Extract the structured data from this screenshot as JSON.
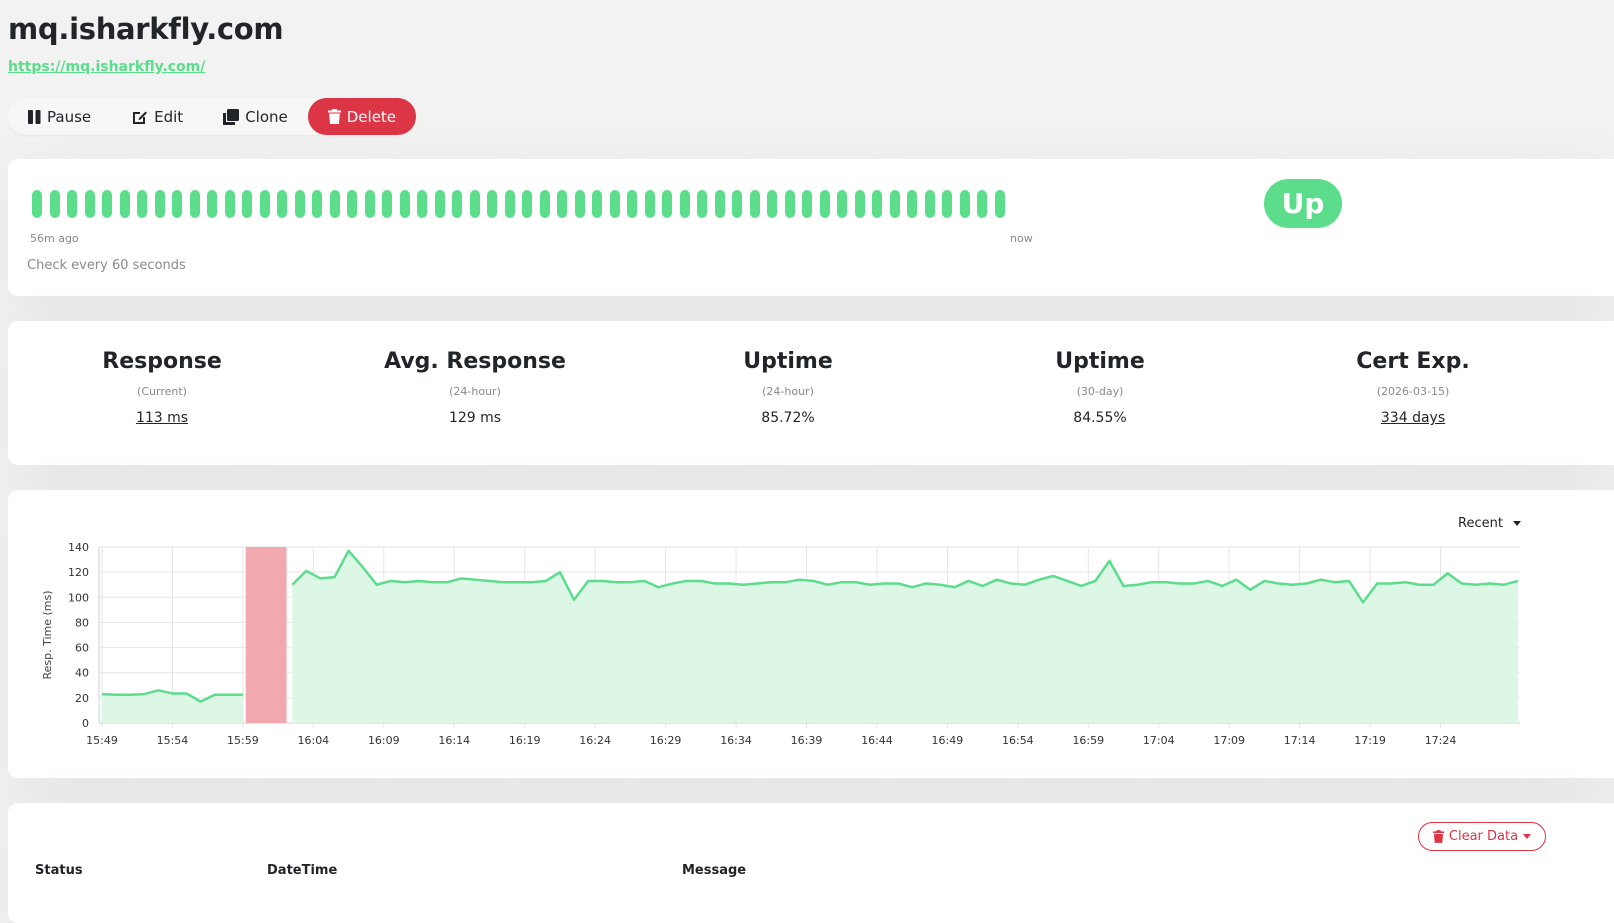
{
  "page": {
    "title": "mq.isharkfly.com",
    "url": "https://mq.isharkfly.com/"
  },
  "toolbar": {
    "pause_label": "Pause",
    "edit_label": "Edit",
    "clone_label": "Clone",
    "delete_label": "Delete"
  },
  "heartbeat": {
    "beat_count": 56,
    "beat_status": "up",
    "left_label": "56m ago",
    "right_label": "now",
    "interval_text": "Check every 60 seconds",
    "status": "Up",
    "colors": {
      "up": "#5cdd8b",
      "down": "#dc3545"
    }
  },
  "stats": [
    {
      "title": "Response",
      "sub": "(Current)",
      "value": "113 ms",
      "link": true
    },
    {
      "title": "Avg. Response",
      "sub": "(24-hour)",
      "value": "129 ms",
      "link": false
    },
    {
      "title": "Uptime",
      "sub": "(24-hour)",
      "value": "85.72%",
      "link": false
    },
    {
      "title": "Uptime",
      "sub": "(30-day)",
      "value": "84.55%",
      "link": false
    },
    {
      "title": "Cert Exp.",
      "sub": "(2026-03-15)",
      "value": "334 days",
      "link": true
    }
  ],
  "chart_period": "Recent",
  "chart_data": {
    "type": "area",
    "ylabel": "Resp. Time (ms)",
    "xlabel": "",
    "ylim": [
      0,
      140
    ],
    "yticks": [
      0,
      20,
      40,
      60,
      80,
      100,
      120,
      140
    ],
    "xticks": [
      "15:49",
      "15:54",
      "15:59",
      "16:04",
      "16:09",
      "16:14",
      "16:19",
      "16:24",
      "16:29",
      "16:34",
      "16:39",
      "16:44",
      "16:49",
      "16:54",
      "16:59",
      "17:04",
      "17:09",
      "17:14",
      "17:19",
      "17:24"
    ],
    "x_range_minutes": [
      0,
      100
    ],
    "line_color": "#5cdd8b",
    "fill_color": "#dcf7e6",
    "down_color": "#f1a8af",
    "down_period": [
      10.2,
      13.1
    ],
    "series": [
      {
        "values": [
          [
            0,
            23
          ],
          [
            1,
            22.5
          ],
          [
            2,
            22.5
          ],
          [
            3,
            23
          ],
          [
            4,
            26
          ],
          [
            5,
            23.5
          ],
          [
            6,
            23.5
          ],
          [
            7,
            17
          ],
          [
            8,
            22.5
          ],
          [
            9,
            22.5
          ],
          [
            10,
            22.5
          ]
        ]
      },
      {
        "values": [
          [
            13.5,
            110
          ],
          [
            14.5,
            121
          ],
          [
            15.5,
            115
          ],
          [
            16.5,
            116
          ],
          [
            17.5,
            137
          ],
          [
            18.5,
            124
          ],
          [
            19.5,
            110
          ],
          [
            20.5,
            113
          ],
          [
            21.5,
            112
          ],
          [
            22.5,
            113
          ],
          [
            23.5,
            112
          ],
          [
            24.5,
            112
          ],
          [
            25.5,
            115
          ],
          [
            26.5,
            114
          ],
          [
            27.5,
            113
          ],
          [
            28.5,
            112
          ],
          [
            29.5,
            112
          ],
          [
            30.5,
            112
          ],
          [
            31.5,
            113
          ],
          [
            32.5,
            120
          ],
          [
            33.5,
            98
          ],
          [
            34.5,
            113
          ],
          [
            35.5,
            113
          ],
          [
            36.5,
            112
          ],
          [
            37.5,
            112
          ],
          [
            38.5,
            113
          ],
          [
            39.5,
            108
          ],
          [
            40.5,
            111
          ],
          [
            41.5,
            113
          ],
          [
            42.5,
            113
          ],
          [
            43.5,
            111
          ],
          [
            44.5,
            111
          ],
          [
            45.5,
            110
          ],
          [
            46.5,
            111
          ],
          [
            47.5,
            112
          ],
          [
            48.5,
            112
          ],
          [
            49.5,
            114
          ],
          [
            50.5,
            113
          ],
          [
            51.5,
            110
          ],
          [
            52.5,
            112
          ],
          [
            53.5,
            112
          ],
          [
            54.5,
            110
          ],
          [
            55.5,
            111
          ],
          [
            56.5,
            111
          ],
          [
            57.5,
            108
          ],
          [
            58.5,
            111
          ],
          [
            59.5,
            110
          ],
          [
            60.5,
            108
          ],
          [
            61.5,
            113
          ],
          [
            62.5,
            109
          ],
          [
            63.5,
            114
          ],
          [
            64.5,
            111
          ],
          [
            65.5,
            110
          ],
          [
            66.5,
            114
          ],
          [
            67.5,
            117
          ],
          [
            68.5,
            113
          ],
          [
            69.5,
            109
          ],
          [
            70.5,
            113
          ],
          [
            71.5,
            129
          ],
          [
            72.5,
            109
          ],
          [
            73.5,
            110
          ],
          [
            74.5,
            112
          ],
          [
            75.5,
            112
          ],
          [
            76.5,
            111
          ],
          [
            77.5,
            111
          ],
          [
            78.5,
            113
          ],
          [
            79.5,
            109
          ],
          [
            80.5,
            114
          ],
          [
            81.5,
            106
          ],
          [
            82.5,
            113
          ],
          [
            83.5,
            111
          ],
          [
            84.5,
            110
          ],
          [
            85.5,
            111
          ],
          [
            86.5,
            114
          ],
          [
            87.5,
            112
          ],
          [
            88.5,
            113
          ],
          [
            89.5,
            96
          ],
          [
            90.5,
            111
          ],
          [
            91.5,
            111
          ],
          [
            92.5,
            112
          ],
          [
            93.5,
            110
          ],
          [
            94.5,
            110
          ],
          [
            95.5,
            119
          ],
          [
            96.5,
            111
          ],
          [
            97.5,
            110
          ],
          [
            98.5,
            111
          ],
          [
            99.5,
            110
          ],
          [
            100.5,
            113
          ]
        ]
      }
    ]
  },
  "events": {
    "clear_label": "Clear Data",
    "columns": [
      "Status",
      "DateTime",
      "Message"
    ]
  }
}
